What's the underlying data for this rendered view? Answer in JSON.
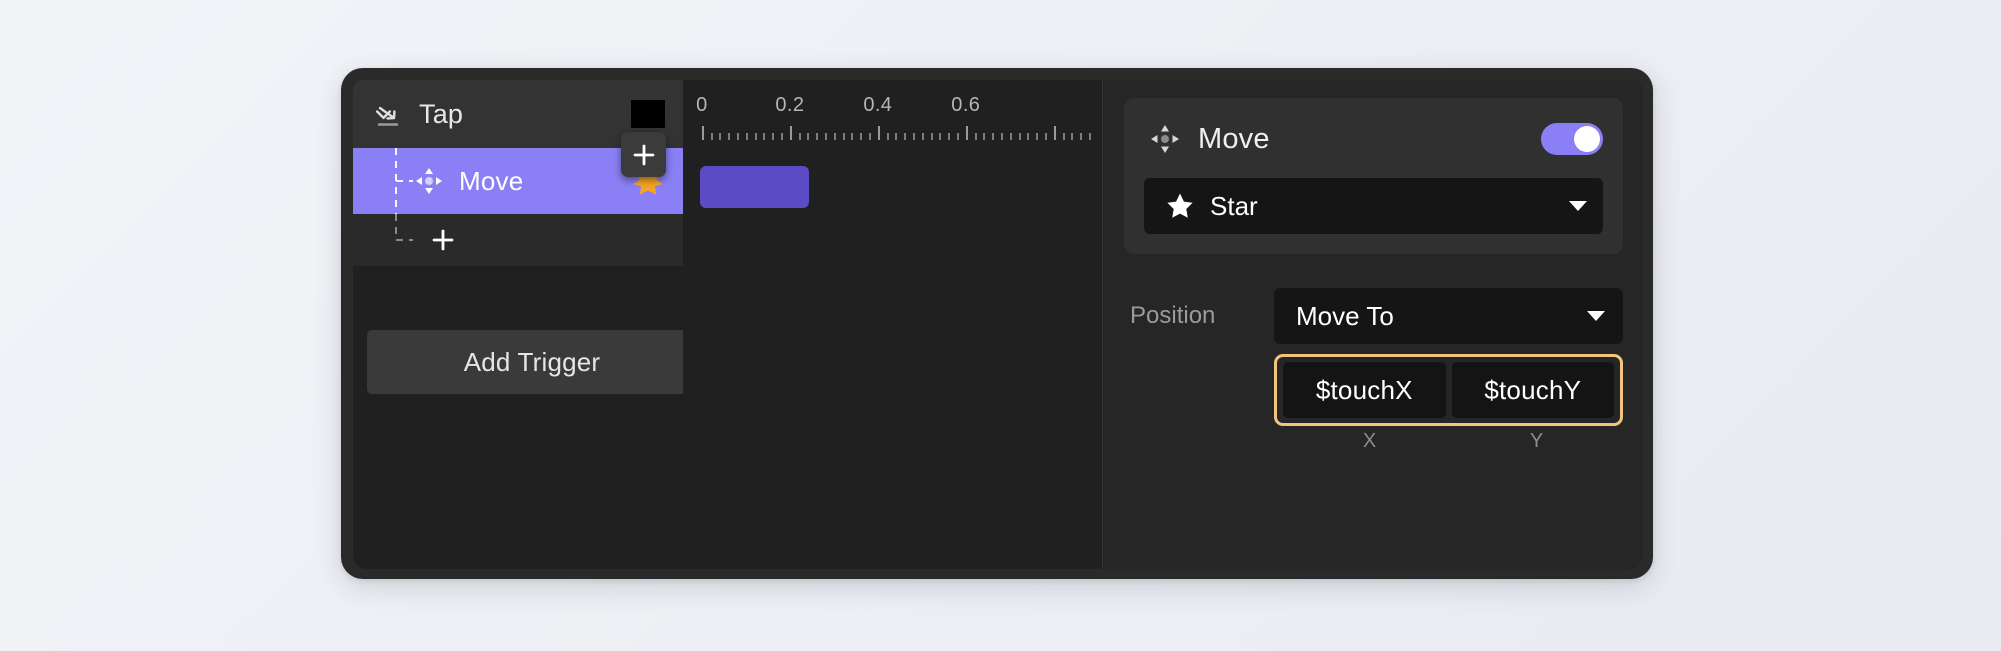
{
  "panel": {
    "trigger": {
      "icon": "tap-gesture-icon",
      "title": "Tap",
      "color_swatch": "#000000",
      "actions": [
        {
          "icon": "move-arrows-icon",
          "label": "Move",
          "badge_icon": "star-burst-icon",
          "selected": true
        }
      ],
      "add_action_glyph": "+",
      "plus_chip_glyph": "+",
      "add_trigger_label": "Add Trigger"
    },
    "timeline": {
      "ruler_labels": [
        "0",
        "0.2",
        "0.4",
        "0.6"
      ],
      "ruler_positions": [
        0.045,
        0.255,
        0.465,
        0.675
      ],
      "tick_count": 48,
      "major_every": 10,
      "clip": {
        "color": "#5b4bc4",
        "start": 0.04,
        "width": 0.26
      }
    },
    "inspector": {
      "action": {
        "icon": "move-arrows-icon",
        "title": "Move",
        "enabled": true,
        "toggle_color": "#8b7ff6",
        "target": {
          "icon": "star-icon",
          "label": "Star",
          "caret": "chevron-down-icon"
        }
      },
      "position": {
        "label": "Position",
        "mode": "Move To",
        "caret": "chevron-down-icon",
        "highlight_color": "#f2c57c",
        "x": {
          "value": "$touchX",
          "caption": "X"
        },
        "y": {
          "value": "$touchY",
          "caption": "Y"
        }
      }
    }
  },
  "theme": {
    "accent": "#8b7ff6",
    "clip": "#5b4bc4",
    "star": "#f5a623",
    "highlight": "#f2c57c",
    "panel_bg": "#2a2a2a",
    "surface": "#202020",
    "inspector_bg": "#262626"
  }
}
